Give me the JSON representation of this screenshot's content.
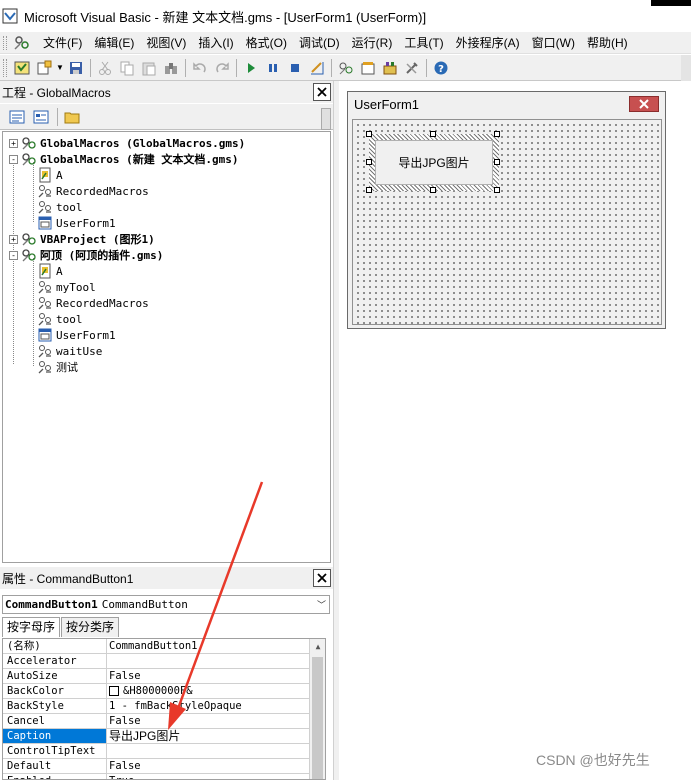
{
  "window": {
    "title": "Microsoft Visual Basic - 新建 文本文档.gms - [UserForm1 (UserForm)]"
  },
  "menu": [
    "文件(F)",
    "编辑(E)",
    "视图(V)",
    "插入(I)",
    "格式(O)",
    "调试(D)",
    "运行(R)",
    "工具(T)",
    "外接程序(A)",
    "窗口(W)",
    "帮助(H)"
  ],
  "toolbar": {
    "icons": [
      "view-excel-icon",
      "insert-module-icon",
      "save-icon",
      "cut-icon",
      "copy-icon",
      "paste-icon",
      "find-icon",
      "undo-icon",
      "redo-icon",
      "run-icon",
      "break-icon",
      "reset-icon",
      "design-mode-icon",
      "project-explorer-icon",
      "properties-window-icon",
      "object-browser-icon",
      "toolbox-icon",
      "help-icon"
    ]
  },
  "project": {
    "title": "工程 - GlobalMacros",
    "items": [
      {
        "label": "GlobalMacros (GlobalMacros.gms)",
        "level": 0,
        "bold": true,
        "expander": "+",
        "icon": "vba-project-icon"
      },
      {
        "label": "GlobalMacros (新建 文本文档.gms)",
        "level": 0,
        "bold": true,
        "expander": "−",
        "icon": "vba-project-icon"
      },
      {
        "label": "A",
        "level": 1,
        "bold": false,
        "expander": "",
        "icon": "document-icon"
      },
      {
        "label": "RecordedMacros",
        "level": 1,
        "bold": false,
        "expander": "",
        "icon": "module-icon"
      },
      {
        "label": "tool",
        "level": 1,
        "bold": false,
        "expander": "",
        "icon": "module-icon"
      },
      {
        "label": "UserForm1",
        "level": 1,
        "bold": false,
        "expander": "",
        "icon": "form-icon"
      },
      {
        "label": "VBAProject (图形1)",
        "level": 0,
        "bold": true,
        "expander": "+",
        "icon": "vba-project-icon"
      },
      {
        "label": "阿顶 (阿顶的插件.gms)",
        "level": 0,
        "bold": true,
        "expander": "−",
        "icon": "vba-project-icon"
      },
      {
        "label": "A",
        "level": 1,
        "bold": false,
        "expander": "",
        "icon": "document-icon"
      },
      {
        "label": "myTool",
        "level": 1,
        "bold": false,
        "expander": "",
        "icon": "module-icon"
      },
      {
        "label": "RecordedMacros",
        "level": 1,
        "bold": false,
        "expander": "",
        "icon": "module-icon"
      },
      {
        "label": "tool",
        "level": 1,
        "bold": false,
        "expander": "",
        "icon": "module-icon"
      },
      {
        "label": "UserForm1",
        "level": 1,
        "bold": false,
        "expander": "",
        "icon": "form-icon"
      },
      {
        "label": "waitUse",
        "level": 1,
        "bold": false,
        "expander": "",
        "icon": "module-icon"
      },
      {
        "label": "测试",
        "level": 1,
        "bold": false,
        "expander": "",
        "icon": "module-icon"
      }
    ]
  },
  "properties": {
    "title": "属性 - CommandButton1",
    "object_name": "CommandButton1",
    "object_type": "CommandButton",
    "tabs": [
      "按字母序",
      "按分类序"
    ],
    "active_tab": 0,
    "rows": [
      {
        "name": "(名称)",
        "value": "CommandButton1"
      },
      {
        "name": "Accelerator",
        "value": ""
      },
      {
        "name": "AutoSize",
        "value": "False"
      },
      {
        "name": "BackColor",
        "value": "&H8000000F&",
        "swatch": true
      },
      {
        "name": "BackStyle",
        "value": "1 - fmBackStyleOpaque"
      },
      {
        "name": "Cancel",
        "value": "False"
      },
      {
        "name": "Caption",
        "value": "导出JPG图片",
        "selected": true
      },
      {
        "name": "ControlTipText",
        "value": ""
      },
      {
        "name": "Default",
        "value": "False"
      },
      {
        "name": "Enabled",
        "value": "True"
      }
    ]
  },
  "form": {
    "title": "UserForm1",
    "button_caption": "导出JPG图片"
  },
  "watermark": "CSDN @也好先生",
  "colors": {
    "selection": "#0078d7",
    "annotation_arrow": "#e8392a",
    "close_button": "#c75050"
  }
}
